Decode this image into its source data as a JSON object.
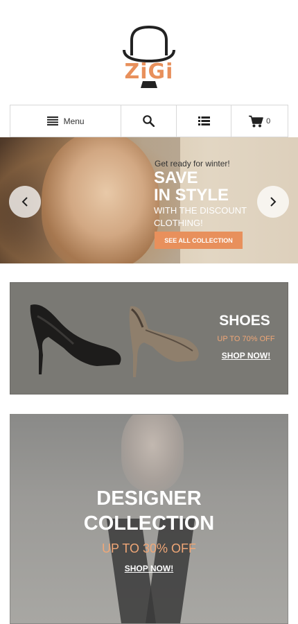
{
  "brand": {
    "name": "ZiGi",
    "accent": "#e8905c"
  },
  "nav": {
    "menu_label": "Menu",
    "cart_count": "0",
    "icons": [
      "hamburger-icon",
      "search-icon",
      "list-icon",
      "cart-icon"
    ]
  },
  "slider": {
    "kicker": "Get ready for winter!",
    "title_line1": "SAVE",
    "title_line2": "IN STYLE",
    "subtitle_line1": "WITH THE DISCOUNT",
    "subtitle_line2": "CLOTHING!",
    "button_label": "SEE ALL COLLECTION"
  },
  "shoes_banner": {
    "title": "SHOES",
    "subtitle": "UP TO 70% OFF",
    "link_label": "SHOP NOW!"
  },
  "designer_banner": {
    "title_line1": "DESIGNER",
    "title_line2": "COLLECTION",
    "subtitle": "UP TO 30% OFF",
    "link_label": "SHOP NOW!"
  }
}
